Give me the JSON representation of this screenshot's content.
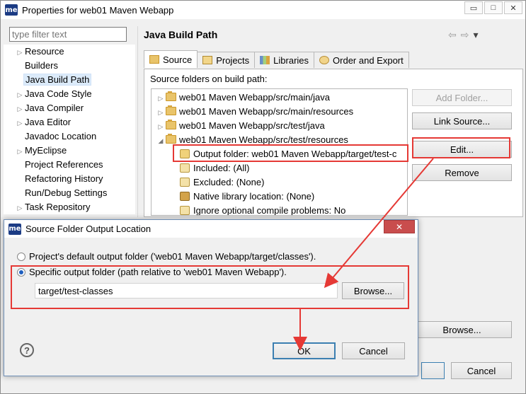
{
  "window": {
    "logo": "me",
    "title": "Properties for web01 Maven Webapp",
    "min": "▭",
    "max": "□",
    "close": "✕"
  },
  "filter": {
    "placeholder": "type filter text"
  },
  "nav": {
    "items": [
      {
        "label": "Resource",
        "arrow": "▷"
      },
      {
        "label": "Builders",
        "arrow": ""
      },
      {
        "label": "Java Build Path",
        "arrow": ""
      },
      {
        "label": "Java Code Style",
        "arrow": "▷"
      },
      {
        "label": "Java Compiler",
        "arrow": "▷"
      },
      {
        "label": "Java Editor",
        "arrow": "▷"
      },
      {
        "label": "Javadoc Location",
        "arrow": ""
      },
      {
        "label": "MyEclipse",
        "arrow": "▷"
      },
      {
        "label": "Project References",
        "arrow": ""
      },
      {
        "label": "Refactoring History",
        "arrow": ""
      },
      {
        "label": "Run/Debug Settings",
        "arrow": ""
      },
      {
        "label": "Task Repository",
        "arrow": "▷"
      }
    ]
  },
  "page": {
    "title": "Java Build Path",
    "back": "⇦",
    "forward": "⇨",
    "menu": "▾"
  },
  "tabs": [
    {
      "label": "Source"
    },
    {
      "label": "Projects"
    },
    {
      "label": "Libraries"
    },
    {
      "label": "Order and Export"
    }
  ],
  "source": {
    "label": "Source folders on build path:",
    "rows": [
      {
        "arrow": "▷",
        "text": "web01 Maven Webapp/src/main/java"
      },
      {
        "arrow": "▷",
        "text": "web01 Maven Webapp/src/main/resources"
      },
      {
        "arrow": "▷",
        "text": "web01 Maven Webapp/src/test/java"
      },
      {
        "arrow": "◢",
        "text": "web01 Maven Webapp/src/test/resources"
      },
      {
        "arrow": "",
        "text": "Output folder: web01 Maven Webapp/target/test-c"
      },
      {
        "arrow": "",
        "text": "Included: (All)"
      },
      {
        "arrow": "",
        "text": "Excluded: (None)"
      },
      {
        "arrow": "",
        "text": "Native library location: (None)"
      },
      {
        "arrow": "",
        "text": "Ignore optional compile problems: No"
      }
    ]
  },
  "buttons": {
    "add_folder": "Add Folder...",
    "link_source": "Link Source...",
    "edit": "Edit...",
    "remove": "Remove",
    "browse_main": "Browse...",
    "cancel_main": "Cancel"
  },
  "dialog": {
    "logo": "me",
    "title": "Source Folder Output Location",
    "close": "✕",
    "radio_default": "Project's default output folder ('web01 Maven Webapp/target/classes').",
    "radio_specific": "Specific output folder (path relative to 'web01 Maven Webapp').",
    "output_value": "target/test-classes",
    "browse": "Browse...",
    "help": "?",
    "ok": "OK",
    "cancel": "Cancel"
  },
  "colors": {
    "highlight": "#e53935",
    "selection": "#dcebfa",
    "accent": "#1f5fbf"
  }
}
